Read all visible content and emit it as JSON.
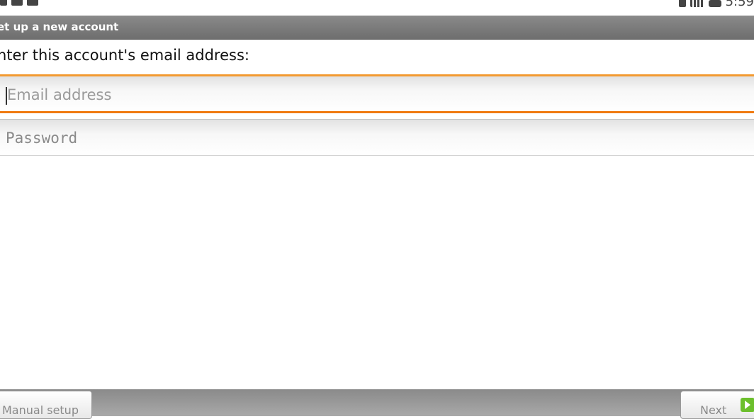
{
  "title_bar": {
    "title": "et up a new account"
  },
  "prompt": "nter this account's email address:",
  "email": {
    "placeholder": "Email address",
    "value": ""
  },
  "password": {
    "placeholder": "Password",
    "value": ""
  },
  "buttons": {
    "manual_setup": "Manual setup",
    "next": "Next"
  },
  "status_bar": {
    "time": "5:59"
  },
  "colors": {
    "accent_focus": "#f39a30",
    "title_bar": "#7a7a7a",
    "next_icon": "#6cbf2c"
  }
}
